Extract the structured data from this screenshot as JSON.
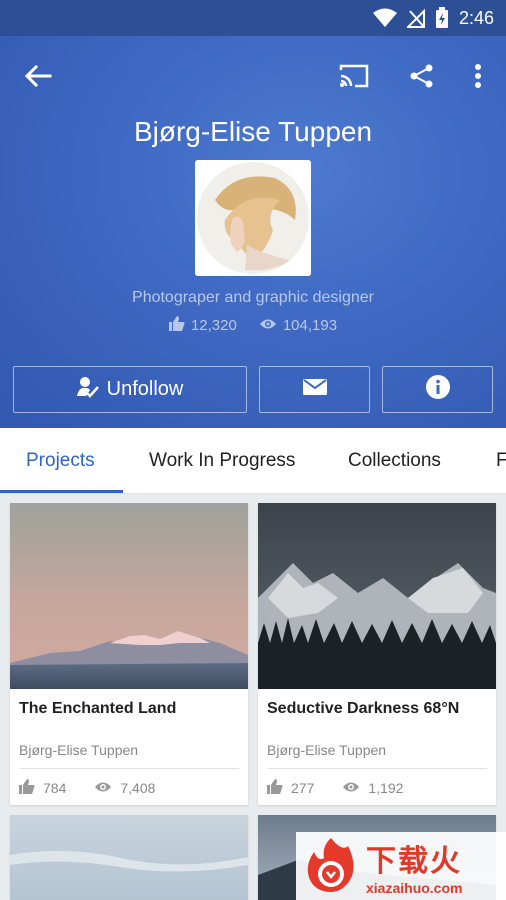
{
  "status_bar": {
    "time": "2:46"
  },
  "profile": {
    "name": "Bjørg-Elise Tuppen",
    "tagline": "Photograper and graphic designer",
    "appreciations": "12,320",
    "views": "104,193"
  },
  "actions": {
    "follow_label": "Unfollow"
  },
  "tabs": [
    {
      "label": "Projects"
    },
    {
      "label": "Work In Progress"
    },
    {
      "label": "Collections"
    },
    {
      "label": "F"
    }
  ],
  "projects": [
    {
      "title": "The Enchanted Land",
      "author": "Bjørg-Elise Tuppen",
      "likes": "784",
      "views": "7,408"
    },
    {
      "title": "Seductive Darkness 68°N",
      "author": "Bjørg-Elise Tuppen",
      "likes": "277",
      "views": "1,192"
    }
  ],
  "watermark": {
    "cn": "下载火",
    "url": "xiazaihuo.com"
  },
  "colors": {
    "header": "#3e68c2",
    "accent": "#2f63c8"
  }
}
